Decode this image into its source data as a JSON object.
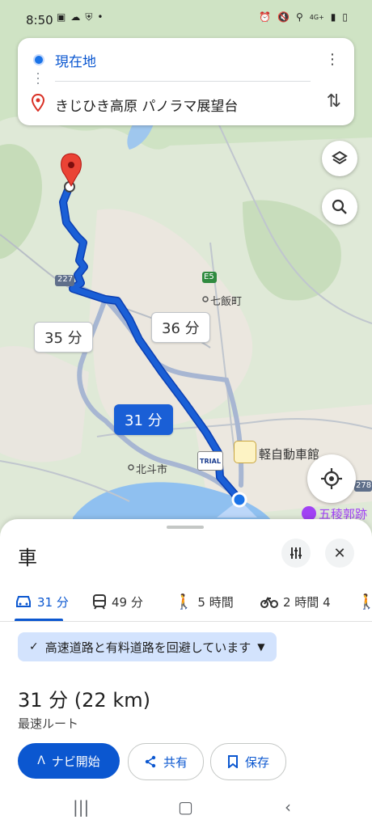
{
  "status_bar": {
    "time": "8:50",
    "left_icons": [
      "photo-icon",
      "cloud-icon",
      "shield-icon",
      "dot-icon"
    ],
    "network_label": "4G+",
    "right_icons": [
      "alarm-icon",
      "mute-icon",
      "location-icon",
      "signal-icon",
      "battery-icon"
    ]
  },
  "directions": {
    "origin": "現在地",
    "destination": "きじひき高原 パノラマ展望台"
  },
  "map": {
    "labels": {
      "road_227": "227",
      "road_e5": "E5",
      "nanae": "七飯町",
      "hokuto": "北斗市",
      "kei_jidosha": "軽自動車館",
      "trial": "TRIAL",
      "goryokaku": "五稜郭跡",
      "road_278": "278"
    },
    "route_bubbles": {
      "main": "31 分",
      "alt1": "35 分",
      "alt2": "36 分"
    },
    "route_color": "#1a5fd6",
    "alt_route_color": "#a7b6d2"
  },
  "sheet": {
    "mode_title": "車",
    "tabs": [
      {
        "icon": "car-icon",
        "label": "31 分"
      },
      {
        "icon": "transit-icon",
        "label": "49 分"
      },
      {
        "icon": "walk-icon",
        "label": "5 時間"
      },
      {
        "icon": "bike-icon",
        "label": "2 時間 4"
      },
      {
        "icon": "ride-icon",
        "label": ""
      }
    ],
    "avoid_chip": "高速道路と有料道路を回避しています",
    "duration": "31 分 (22 km)",
    "route_desc": "最速ルート",
    "buttons": {
      "start": "ナビ開始",
      "share": "共有",
      "save": "保存"
    }
  }
}
